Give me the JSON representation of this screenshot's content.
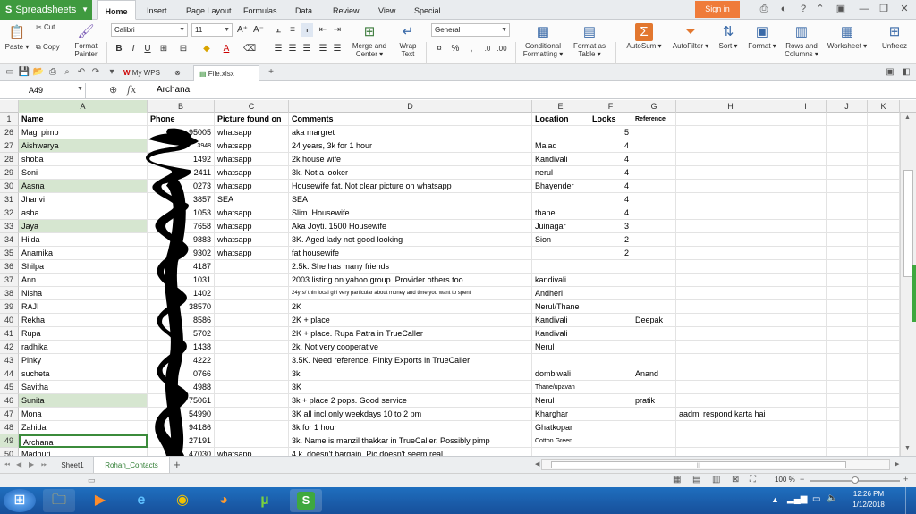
{
  "app": {
    "name": "Spreadsheets"
  },
  "menu": {
    "tabs": [
      "Home",
      "Insert",
      "Page Layout",
      "Formulas",
      "Data",
      "Review",
      "View",
      "Special Features"
    ],
    "active_tab": "Home",
    "signin": "Sign in"
  },
  "ribbon": {
    "paste": "Paste",
    "cut": "Cut",
    "copy": "Copy",
    "format_painter_1": "Format",
    "format_painter_2": "Painter",
    "font_name": "Calibri",
    "font_size": "11",
    "merge_1": "Merge and",
    "merge_2": "Center",
    "wrap_1": "Wrap",
    "wrap_2": "Text",
    "number_format": "General",
    "cond_1": "Conditional",
    "cond_2": "Formatting",
    "fmt_table_1": "Format as",
    "fmt_table_2": "Table",
    "autosum": "AutoSum",
    "autofilter": "AutoFilter",
    "sort": "Sort",
    "format": "Format",
    "rows_cols_1": "Rows and",
    "rows_cols_2": "Columns",
    "worksheet": "Worksheet",
    "unfreeze": "Unfreez"
  },
  "doc_tabs": [
    "My WPS",
    "File.xlsx"
  ],
  "formula_bar": {
    "name_box": "A49",
    "fx": "fx",
    "content": "Archana"
  },
  "columns": [
    "A",
    "B",
    "C",
    "D",
    "E",
    "F",
    "G",
    "H",
    "I",
    "J",
    "K"
  ],
  "header_row": {
    "num": "1",
    "cells": [
      "Name",
      "Phone",
      "Picture found on",
      "Comments",
      "Location",
      "Looks",
      "Reference",
      "",
      "",
      "",
      ""
    ]
  },
  "rows": [
    {
      "num": "26",
      "hl": false,
      "cells": [
        "Magi pimp",
        "95005",
        "whatsapp",
        "aka margret",
        "",
        "5",
        "",
        "",
        "",
        "",
        ""
      ]
    },
    {
      "num": "27",
      "hl": true,
      "cells": [
        "Aishwarya",
        "3948",
        "whatsapp",
        "24 years, 3k for 1 hour",
        "Malad",
        "4",
        "",
        "",
        "",
        "",
        ""
      ]
    },
    {
      "num": "28",
      "hl": false,
      "cells": [
        "shoba",
        "1492",
        "whatsapp",
        "2k house wife",
        "Kandivali",
        "4",
        "",
        "",
        "",
        "",
        ""
      ]
    },
    {
      "num": "29",
      "hl": false,
      "cells": [
        "Soni",
        "2411",
        "whatsapp",
        "3k. Not a looker",
        "nerul",
        "4",
        "",
        "",
        "",
        "",
        ""
      ]
    },
    {
      "num": "30",
      "hl": true,
      "cells": [
        "Aasna",
        "0273",
        "whatsapp",
        "Housewife fat. Not clear picture on whatsapp",
        "Bhayender",
        "4",
        "",
        "",
        "",
        "",
        ""
      ]
    },
    {
      "num": "31",
      "hl": false,
      "cells": [
        "Jhanvi",
        "3857",
        "SEA",
        "SEA",
        "",
        "4",
        "",
        "",
        "",
        "",
        ""
      ]
    },
    {
      "num": "32",
      "hl": false,
      "cells": [
        "asha",
        "1053",
        "whatsapp",
        "Slim. Housewife",
        "thane",
        "4",
        "",
        "",
        "",
        "",
        ""
      ]
    },
    {
      "num": "33",
      "hl": true,
      "cells": [
        "Jaya",
        "7658",
        "whatsapp",
        "Aka Joyti. 1500 Housewife",
        "Juinagar",
        "3",
        "",
        "",
        "",
        "",
        ""
      ]
    },
    {
      "num": "34",
      "hl": false,
      "cells": [
        "Hilda",
        "9883",
        "whatsapp",
        "3K. Aged lady not good looking",
        "Sion",
        "2",
        "",
        "",
        "",
        "",
        ""
      ]
    },
    {
      "num": "35",
      "hl": false,
      "cells": [
        "Anamika",
        "9302",
        "whatsapp",
        "fat housewife",
        "",
        "2",
        "",
        "",
        "",
        "",
        ""
      ]
    },
    {
      "num": "36",
      "hl": false,
      "cells": [
        "Shilpa",
        "4187",
        "",
        "2.5k. She has many friends",
        "",
        "",
        "",
        "",
        "",
        "",
        ""
      ]
    },
    {
      "num": "37",
      "hl": false,
      "cells": [
        "Ann",
        "1031",
        "",
        "2003 listing on yahoo group. Provider others too",
        "kandivali",
        "",
        "",
        "",
        "",
        "",
        ""
      ]
    },
    {
      "num": "38",
      "hl": false,
      "cells": [
        "Nisha",
        "1402",
        "",
        "24yrs/ thin local girl very particular about money and time you want to spent",
        "Andheri",
        "",
        "",
        "",
        "",
        "",
        ""
      ]
    },
    {
      "num": "39",
      "hl": false,
      "cells": [
        "RAJI",
        "38570",
        "",
        "2K",
        "Nerul/Thane",
        "",
        "",
        "",
        "",
        "",
        ""
      ]
    },
    {
      "num": "40",
      "hl": false,
      "cells": [
        "Rekha",
        "8586",
        "",
        "2K + place",
        "Kandivali",
        "",
        "Deepak",
        "",
        "",
        "",
        ""
      ]
    },
    {
      "num": "41",
      "hl": false,
      "cells": [
        "Rupa",
        "5702",
        "",
        "2K + place. Rupa Patra in TrueCaller",
        "Kandivali",
        "",
        "",
        "",
        "",
        "",
        ""
      ]
    },
    {
      "num": "42",
      "hl": false,
      "cells": [
        "radhika",
        "1438",
        "",
        "2k. Not very cooperative",
        "Nerul",
        "",
        "",
        "",
        "",
        "",
        ""
      ]
    },
    {
      "num": "43",
      "hl": false,
      "cells": [
        "Pinky",
        "4222",
        "",
        "3.5K. Need reference. Pinky Exports in TrueCaller",
        "",
        "",
        "",
        "",
        "",
        "",
        ""
      ]
    },
    {
      "num": "44",
      "hl": false,
      "cells": [
        "sucheta",
        "0766",
        "",
        "3k",
        "dombiwali",
        "",
        "Anand",
        "",
        "",
        "",
        ""
      ]
    },
    {
      "num": "45",
      "hl": false,
      "cells": [
        "Savitha",
        "4988",
        "",
        "3K",
        "Thane/upavan",
        "",
        "",
        "",
        "",
        "",
        ""
      ]
    },
    {
      "num": "46",
      "hl": true,
      "cells": [
        "Sunita",
        "75061",
        "",
        "3k + place 2 pops. Good service",
        "Nerul",
        "",
        "pratik",
        "",
        "",
        "",
        ""
      ]
    },
    {
      "num": "47",
      "hl": false,
      "cells": [
        "Mona",
        "54990",
        "",
        "3K all incl.only weekdays 10 to 2 pm",
        "Kharghar",
        "",
        "",
        "aadmi respond karta hai",
        "",
        "",
        ""
      ]
    },
    {
      "num": "48",
      "hl": false,
      "cells": [
        "Zahida",
        "94186",
        "",
        "3k for 1 hour",
        "Ghatkopar",
        "",
        "",
        "",
        "",
        "",
        ""
      ]
    },
    {
      "num": "49",
      "hl": false,
      "cells": [
        "Archana",
        "27191",
        "",
        "3k. Name is manzil thakkar in TrueCaller. Possibly pimp",
        "Cotton Green",
        "",
        "",
        "",
        "",
        "",
        ""
      ]
    },
    {
      "num": "50",
      "hl": false,
      "cells": [
        "Madhuri",
        "47030",
        "whatsapp",
        "4 k. doesn't bargain. Pic doesn't seem real",
        "",
        "",
        "",
        "",
        "",
        "",
        ""
      ]
    }
  ],
  "sheets": [
    "Sheet1",
    "Rohan_Contacts"
  ],
  "active_sheet": "Rohan_Contacts",
  "status": {
    "zoom": "100 %"
  },
  "taskbar": {
    "time": "12:26 PM",
    "date": "1/12/2018"
  }
}
